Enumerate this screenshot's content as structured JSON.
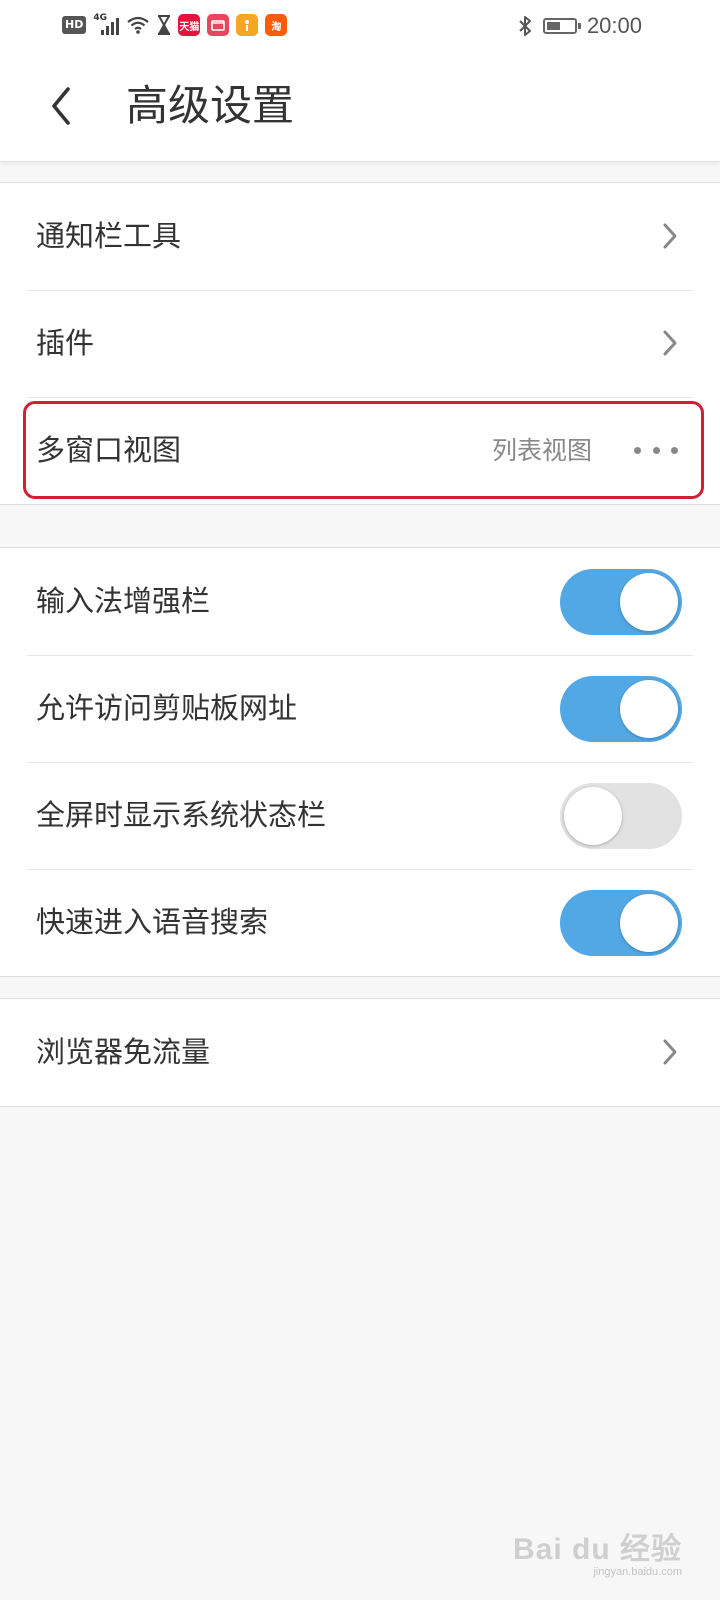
{
  "status_bar": {
    "hd_badge": "HD",
    "network_type": "4G",
    "app_icons": [
      {
        "name": "tmall-app-icon",
        "label": "天猫",
        "color": "#e0163d"
      },
      {
        "name": "video-app-icon",
        "label": "",
        "color": "#e8465f"
      },
      {
        "name": "orange-app-icon",
        "label": "",
        "color": "#f5a623"
      },
      {
        "name": "taobao-app-icon",
        "label": "淘",
        "color": "#ff5b0d"
      }
    ],
    "battery_level": 0.5,
    "time": "20:00"
  },
  "header": {
    "title": "高级设置"
  },
  "groups": {
    "general": {
      "items": [
        {
          "label": "通知栏工具"
        },
        {
          "label": "插件"
        },
        {
          "label": "多窗口视图",
          "value": "列表视图"
        }
      ]
    },
    "toggles": {
      "items": [
        {
          "label": "输入法增强栏",
          "enabled": true
        },
        {
          "label": "允许访问剪贴板网址",
          "enabled": true
        },
        {
          "label": "全屏时显示系统状态栏",
          "enabled": false
        },
        {
          "label": "快速进入语音搜索",
          "enabled": true
        }
      ]
    },
    "data_saver": {
      "items": [
        {
          "label": "浏览器免流量"
        }
      ]
    }
  },
  "colors": {
    "toggle_on": "#52a8e5",
    "toggle_off": "#e2e2e2",
    "highlight": "#d41e36",
    "background": "#f7f7f7"
  },
  "watermark": {
    "main": "Bai du 经验",
    "sub": "jingyan.baidu.com"
  }
}
